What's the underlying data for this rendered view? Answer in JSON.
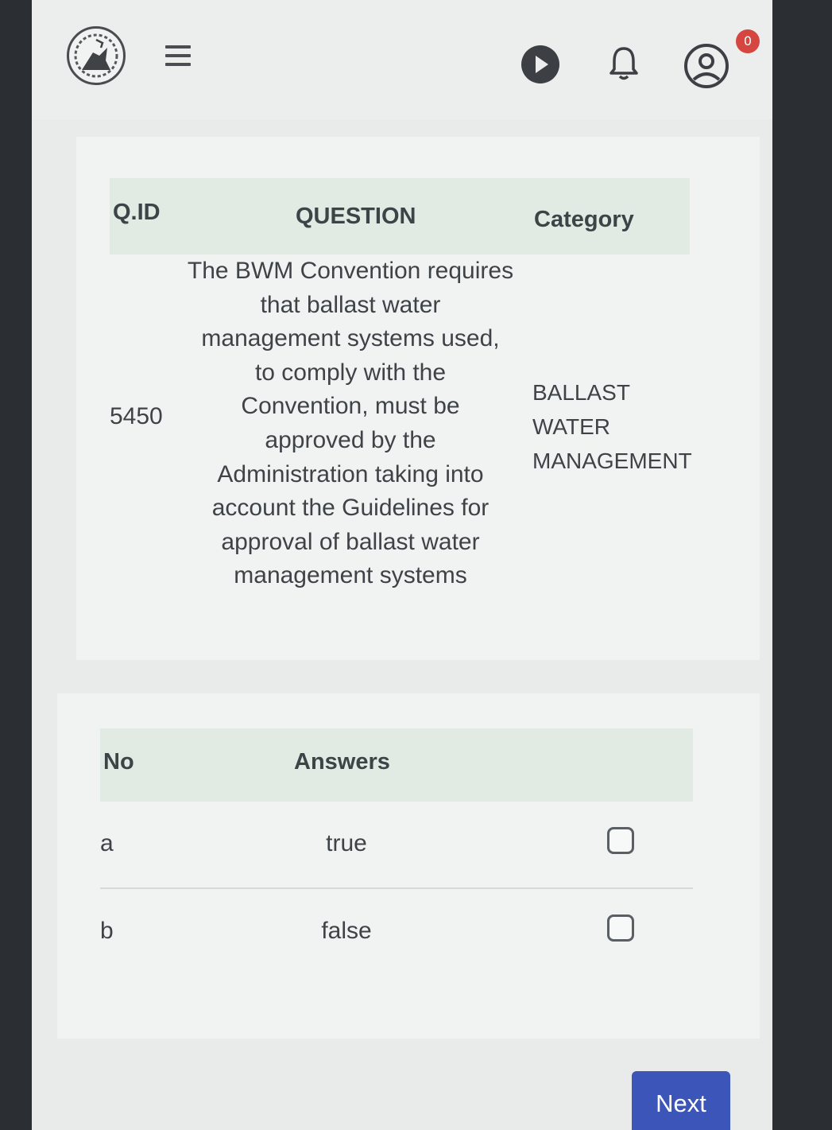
{
  "header": {
    "logo_icon": "ship-crest-logo-icon",
    "menu_icon": "hamburger-menu-icon",
    "play_icon": "play-icon",
    "bell_icon": "bell-icon",
    "user_icon": "user-account-icon",
    "notification_count": "0",
    "badge_color": "#d4463f"
  },
  "question_table": {
    "columns": [
      "Q.ID",
      "QUESTION",
      "Category"
    ],
    "row": {
      "id": "5450",
      "lines": [
        "The BWM Convention requires",
        "that ballast water",
        "management systems used,",
        "to comply with the",
        "Convention, must be",
        "approved by the",
        "Administration taking into",
        "account the Guidelines for",
        "approval of ballast water",
        "management systems"
      ],
      "category": "BALLAST WATER MANAGEMENT"
    }
  },
  "answers_table": {
    "columns": [
      "No",
      "Answers"
    ],
    "rows": [
      {
        "no": "a",
        "answer": "true",
        "checked": false
      },
      {
        "no": "b",
        "answer": "false",
        "checked": false
      }
    ]
  },
  "footer": {
    "next_label": "Next",
    "accent": "#3b55b8"
  }
}
